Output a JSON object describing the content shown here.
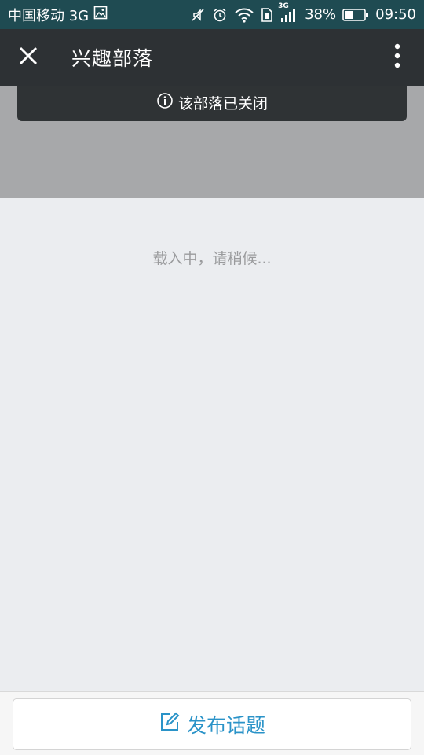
{
  "status_bar": {
    "carrier": "中国移动 3G",
    "network_badge": "3G",
    "battery": "38%",
    "time": "09:50",
    "icons": [
      "image-icon",
      "mute-icon",
      "alarm-icon",
      "wifi-icon",
      "sim-icon",
      "signal-icon",
      "battery-icon"
    ]
  },
  "app_bar": {
    "title": "兴趣部落",
    "icons": [
      "close-icon",
      "more-vertical-icon"
    ]
  },
  "banner": {
    "text": "该部落已关闭",
    "icon": "info-icon"
  },
  "content": {
    "loading_text": "载入中，请稍候..."
  },
  "bottom": {
    "post_label": "发布话题",
    "icon": "edit-icon",
    "accent_color": "#2a93c8"
  },
  "colors": {
    "status_bar_bg": "#1f4b52",
    "app_bar_bg": "#2d3134",
    "cover_bg": "#a7a8aa",
    "page_bg": "#ebedf0"
  }
}
